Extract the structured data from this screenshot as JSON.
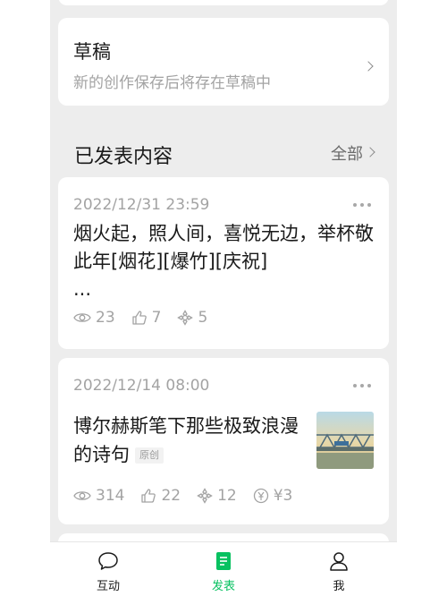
{
  "draft": {
    "title": "草稿",
    "subtitle": "新的创作保存后将存在草稿中"
  },
  "published": {
    "title": "已发表内容",
    "all_label": "全部"
  },
  "posts": [
    {
      "date": "2022/12/31 23:59",
      "body": "烟火起，照人间，喜悦无边，举杯敬此年[烟花][爆竹][庆祝]",
      "ellipsis": "...",
      "views": "23",
      "likes": "7",
      "shares": "5"
    },
    {
      "date": "2022/12/14 08:00",
      "title": "博尔赫斯笔下那些极致浪漫的诗句",
      "tag": "原创",
      "views": "314",
      "likes": "22",
      "shares": "12",
      "reward": "¥3"
    }
  ],
  "tabs": [
    {
      "label": "互动",
      "icon": "chat-bubble-icon"
    },
    {
      "label": "发表",
      "icon": "document-icon",
      "active": true
    },
    {
      "label": "我",
      "icon": "person-icon"
    }
  ],
  "colors": {
    "accent": "#07c160",
    "background": "#ededed",
    "muted_text": "#a3a3a3"
  }
}
